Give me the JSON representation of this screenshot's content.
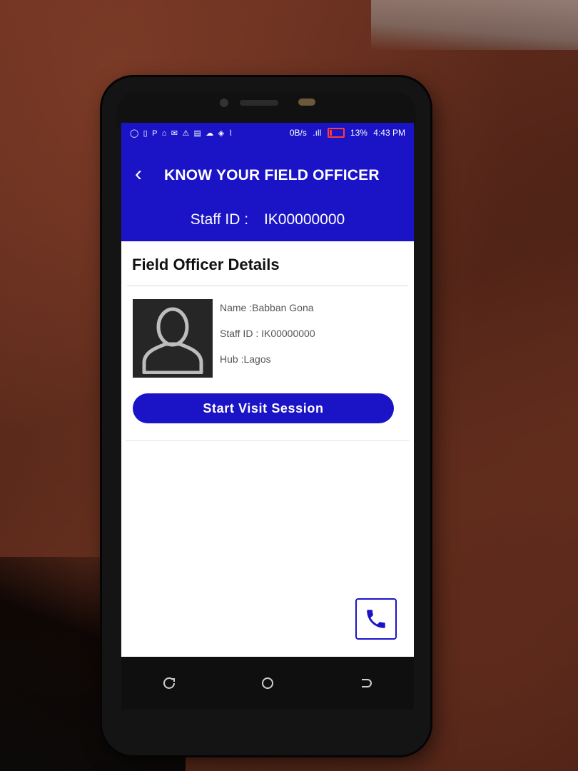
{
  "status_bar": {
    "left_icons": [
      "◯",
      "▯",
      "P",
      "⌂",
      "✉",
      "⚠",
      "▤",
      "☁",
      "◈",
      "⌇"
    ],
    "network_speed": "0B/s",
    "signal": ".ıll",
    "battery_percent": "13%",
    "time": "4:43 PM"
  },
  "header": {
    "back_icon": "‹",
    "title": "KNOW YOUR FIELD OFFICER",
    "staff_id_label": "Staff ID :",
    "staff_id_value": "IK00000000"
  },
  "details": {
    "section_title": "Field Officer Details",
    "name": "Name :Babban Gona",
    "staff_id": "Staff ID :  IK00000000",
    "hub": "Hub :Lagos"
  },
  "actions": {
    "start_visit": "Start Visit Session"
  },
  "colors": {
    "primary": "#1b14c7",
    "avatar_bg": "#262626"
  }
}
